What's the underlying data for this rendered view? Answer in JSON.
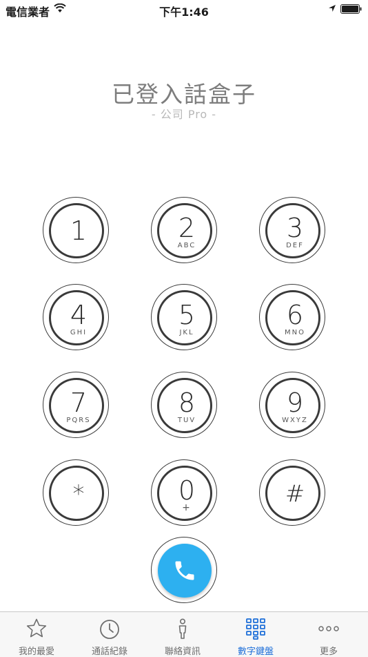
{
  "status_bar": {
    "carrier": "電信業者",
    "time": "下午1:46"
  },
  "header": {
    "title": "已登入話盒子",
    "subtitle": "- 公司 Pro -"
  },
  "keypad": {
    "keys": [
      {
        "digit": "1",
        "letters": ""
      },
      {
        "digit": "2",
        "letters": "ABC"
      },
      {
        "digit": "3",
        "letters": "DEF"
      },
      {
        "digit": "4",
        "letters": "GHI"
      },
      {
        "digit": "5",
        "letters": "JKL"
      },
      {
        "digit": "6",
        "letters": "MNO"
      },
      {
        "digit": "7",
        "letters": "PQRS"
      },
      {
        "digit": "8",
        "letters": "TUV"
      },
      {
        "digit": "9",
        "letters": "WXYZ"
      },
      {
        "digit": "*",
        "letters": ""
      },
      {
        "digit": "0",
        "letters": "+"
      },
      {
        "digit": "#",
        "letters": ""
      }
    ],
    "call_icon": "phone-icon",
    "call_color": "#2db0f0"
  },
  "tab_bar": {
    "tabs": [
      {
        "label": "我的最愛",
        "icon": "star-icon"
      },
      {
        "label": "通話紀錄",
        "icon": "clock-icon"
      },
      {
        "label": "聯絡資訊",
        "icon": "person-icon"
      },
      {
        "label": "數字鍵盤",
        "icon": "keypad-icon"
      },
      {
        "label": "更多",
        "icon": "more-icon"
      }
    ],
    "active_tab": "數字鍵盤",
    "active_color": "#1e6fd9"
  }
}
